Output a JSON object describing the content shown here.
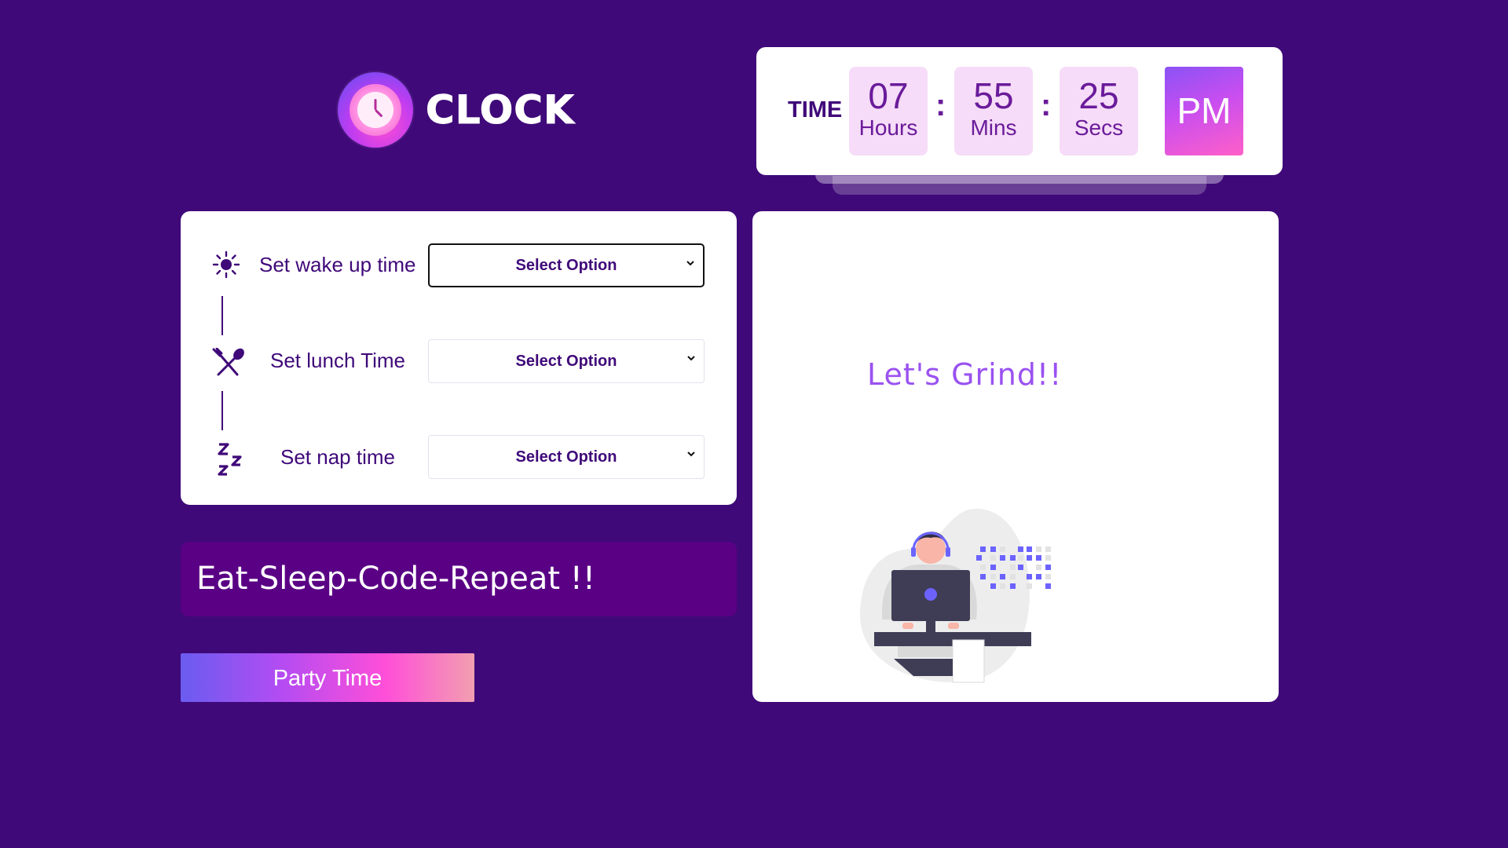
{
  "logo": {
    "text": "CLOCK",
    "icon": "clock-icon"
  },
  "time": {
    "label": "TIME",
    "hours": {
      "value": "07",
      "unit": "Hours"
    },
    "minutes": {
      "value": "55",
      "unit": "Mins"
    },
    "seconds": {
      "value": "25",
      "unit": "Secs"
    },
    "separator": ":",
    "ampm": "PM"
  },
  "settings": {
    "wake": {
      "label": "Set wake up time",
      "select": "Select Option",
      "icon": "sun-icon"
    },
    "lunch": {
      "label": "Set lunch Time",
      "select": "Select Option",
      "icon": "utensils-icon"
    },
    "nap": {
      "label": "Set nap time",
      "select": "Select Option",
      "icon": "sleep-icon"
    }
  },
  "motto": "Eat-Sleep-Code-Repeat !!",
  "party_button": "Party Time",
  "message": "Let's Grind!!",
  "colors": {
    "background": "#3f0979",
    "accent_purple": "#9a52f0",
    "time_box": "#f6dcf8",
    "motto_bg": "#5a0085"
  }
}
